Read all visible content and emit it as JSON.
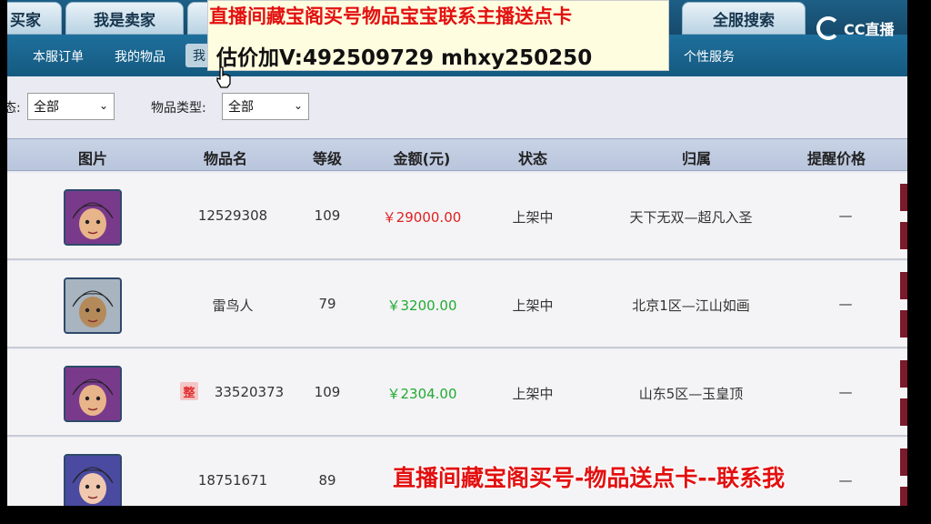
{
  "tabs": {
    "buyer": "买家",
    "seller": "我是卖家",
    "search": "全服搜索"
  },
  "subnav": {
    "orders": "本服订单",
    "items": "我的物品",
    "active": "我",
    "personal": "个性服务"
  },
  "filters": {
    "status_label": "态:",
    "status_value": "全部",
    "type_label": "物品类型:",
    "type_value": "全部"
  },
  "table": {
    "headers": [
      "图片",
      "物品名",
      "等级",
      "金额(元)",
      "状态",
      "归属",
      "提醒价格"
    ],
    "rows": [
      {
        "name": "12529308",
        "badge": "",
        "level": "109",
        "price": "￥29000.00",
        "price_color": "#e02020",
        "status": "上架中",
        "owner": "天下无双—超凡入圣",
        "remind": "—",
        "avatar": "purple-hair-hero"
      },
      {
        "name": "雷鸟人",
        "badge": "",
        "level": "79",
        "price": "￥3200.00",
        "price_color": "#22aa33",
        "status": "上架中",
        "owner": "北京1区—江山如画",
        "remind": "—",
        "avatar": "thunderbird-monster"
      },
      {
        "name": "33520373",
        "badge": "整",
        "level": "109",
        "price": "￥2304.00",
        "price_color": "#22aa33",
        "status": "上架中",
        "owner": "山东5区—玉皇顶",
        "remind": "—",
        "avatar": "purple-hair-hero"
      },
      {
        "name": "18751671",
        "badge": "",
        "level": "89",
        "price": "",
        "price_color": "#22aa33",
        "status": "",
        "owner": "",
        "remind": "—",
        "avatar": "blue-hair-heroine"
      }
    ]
  },
  "overlay": {
    "line1": "直播间藏宝阁买号物品宝宝联系主播送点卡",
    "line2": "估价加V:492509729    mhxy250250",
    "bottom": "直播间藏宝阁买号-物品送点卡--联系我"
  },
  "logo": {
    "text": "CC直播"
  },
  "icons": {
    "cursor": "hand-pointer-icon",
    "dropdown": "chevron-down-icon"
  }
}
